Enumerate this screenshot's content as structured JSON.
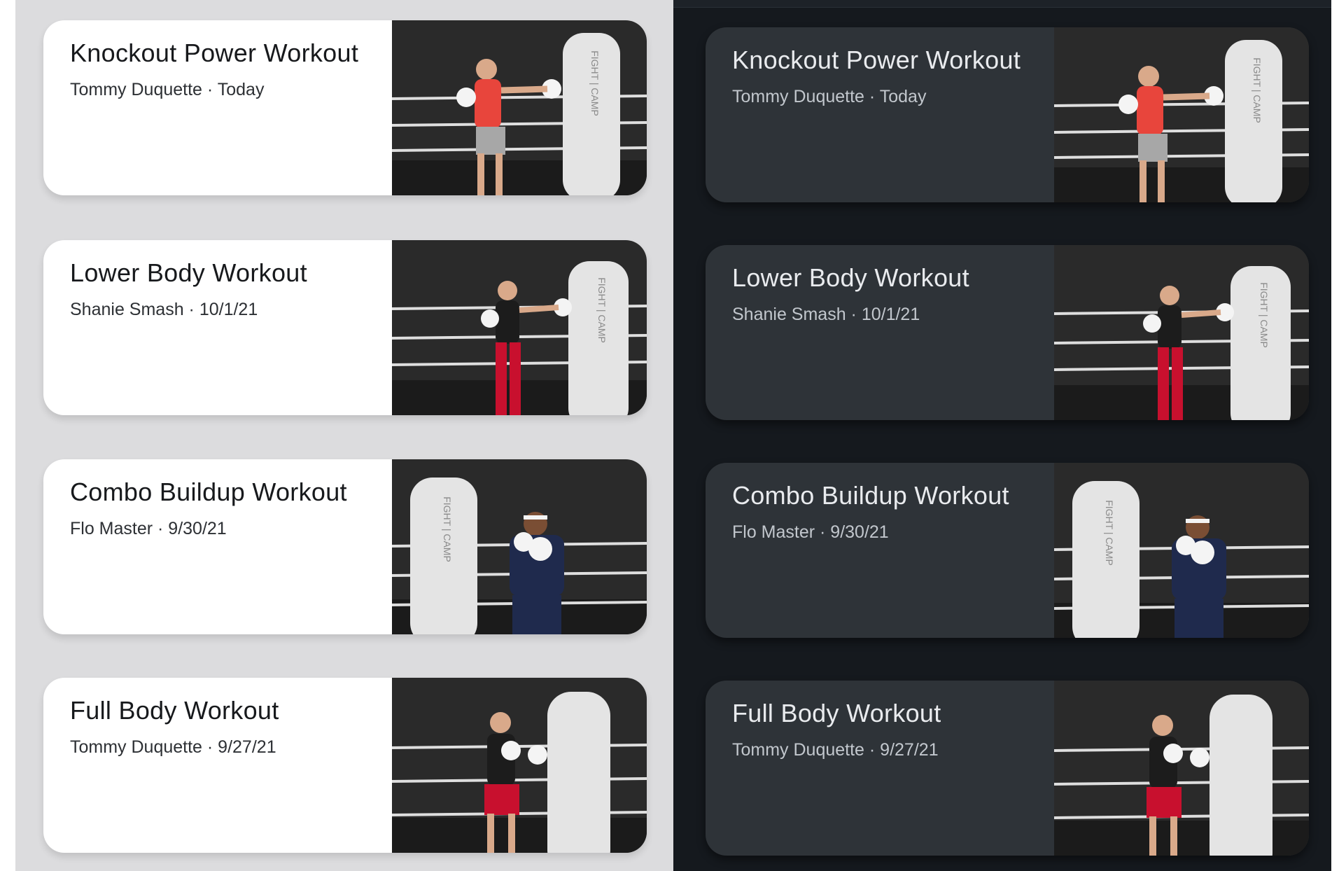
{
  "panels": {
    "light": {
      "cards": [
        {
          "title": "Knockout Power Workout",
          "subtitle": "Tommy Duquette · Today"
        },
        {
          "title": "Lower Body Workout",
          "subtitle": "Shanie Smash · 10/1/21"
        },
        {
          "title": "Combo Buildup Workout",
          "subtitle": "Flo Master · 9/30/21"
        },
        {
          "title": "Full Body Workout",
          "subtitle": "Tommy Duquette · 9/27/21"
        }
      ]
    },
    "dark": {
      "cards": [
        {
          "title": "Knockout Power Workout",
          "subtitle": "Tommy Duquette · Today"
        },
        {
          "title": "Lower Body Workout",
          "subtitle": "Shanie Smash · 10/1/21"
        },
        {
          "title": "Combo Buildup Workout",
          "subtitle": "Flo Master · 9/30/21"
        },
        {
          "title": "Full Body Workout",
          "subtitle": "Tommy Duquette · 9/27/21"
        }
      ]
    }
  },
  "bag_text": "FIGHT | CAMP",
  "colors": {
    "light_background": "#dcdcde",
    "dark_background": "#15191e",
    "light_card": "#ffffff",
    "dark_card": "#2e3338",
    "shirt_red": "#e8453c",
    "shirt_black": "#1c1c1c",
    "shirt_navy": "#1f2a4d",
    "pants_red": "#c8102e"
  }
}
